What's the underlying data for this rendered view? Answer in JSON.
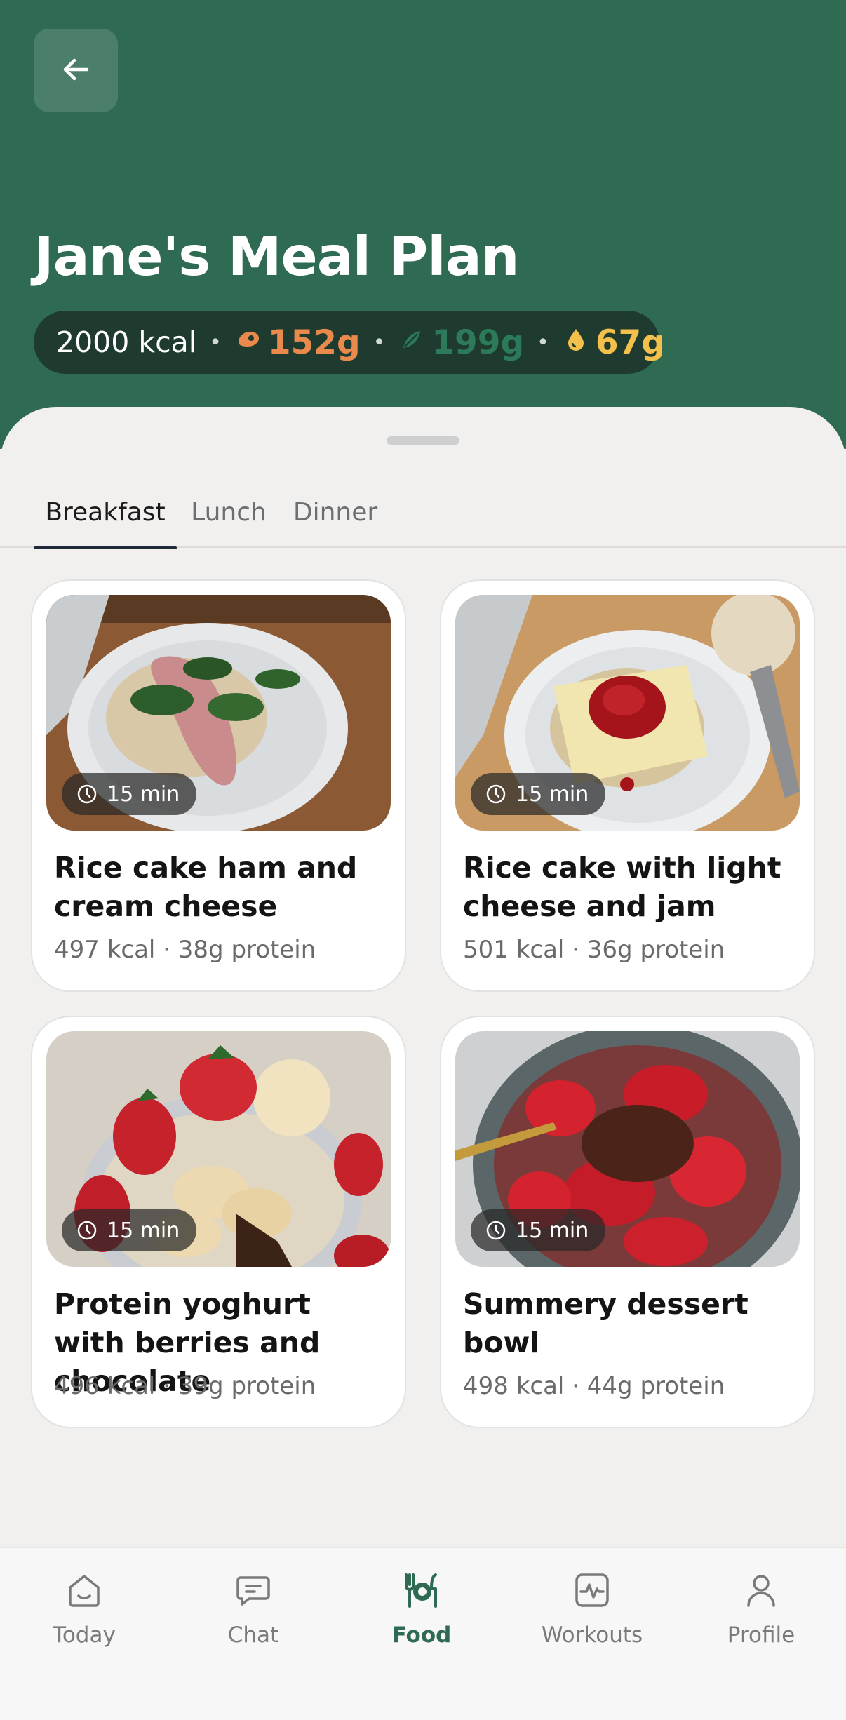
{
  "header": {
    "title": "Jane's Meal Plan",
    "kcal": "2000 kcal",
    "protein": "152g",
    "carbs": "199g",
    "fat": "67g",
    "colors": {
      "background": "#2f6b52",
      "protein": "#e98a4c",
      "carbs": "#2c7a59",
      "fat": "#f3c04b"
    }
  },
  "tabs": [
    {
      "label": "Breakfast",
      "active": true
    },
    {
      "label": "Lunch",
      "active": false
    },
    {
      "label": "Dinner",
      "active": false
    }
  ],
  "meals": [
    {
      "time": "15 min",
      "title": "Rice cake ham and cream cheese",
      "meta": "497 kcal · 38g protein"
    },
    {
      "time": "15 min",
      "title": "Rice cake with light cheese and jam",
      "meta": "501 kcal · 36g protein"
    },
    {
      "time": "15 min",
      "title": "Protein yoghurt with berries and chocolate",
      "meta": "496 kcal · 39g protein"
    },
    {
      "time": "15 min",
      "title": "Summery dessert bowl",
      "meta": "498 kcal · 44g protein"
    }
  ],
  "nav": [
    {
      "label": "Today",
      "icon": "home-icon"
    },
    {
      "label": "Chat",
      "icon": "chat-icon"
    },
    {
      "label": "Food",
      "icon": "food-icon",
      "active": true
    },
    {
      "label": "Workouts",
      "icon": "workouts-icon"
    },
    {
      "label": "Profile",
      "icon": "profile-icon"
    }
  ]
}
